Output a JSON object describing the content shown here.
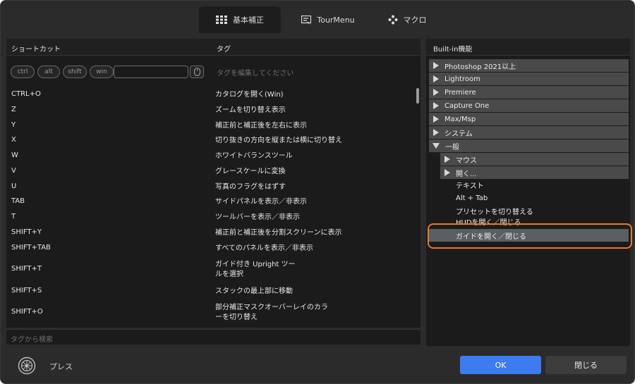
{
  "tabs": [
    {
      "label": "基本補正",
      "icon": "grid-icon",
      "active": true
    },
    {
      "label": "TourMenu",
      "icon": "menu-card-icon",
      "active": false
    },
    {
      "label": "マクロ",
      "icon": "macro-dots-icon",
      "active": false
    }
  ],
  "left": {
    "col_shortcut": "ショートカット",
    "col_tag": "タグ",
    "modifiers": [
      "ctrl",
      "alt",
      "shift",
      "win"
    ],
    "tag_edit_placeholder": "タグを編集してください",
    "rows": [
      {
        "key": "CTRL+O",
        "tag": "カタログを開く(Win)"
      },
      {
        "key": "Z",
        "tag": "ズームを切り替え表示"
      },
      {
        "key": "Y",
        "tag": "補正前と補正後を左右に表示"
      },
      {
        "key": "X",
        "tag": "切り抜きの方向を縦または横に切り替え"
      },
      {
        "key": "W",
        "tag": "ホワイトバランスツール"
      },
      {
        "key": "V",
        "tag": "グレースケールに変換"
      },
      {
        "key": "U",
        "tag": "写真のフラグをはずす"
      },
      {
        "key": "TAB",
        "tag": "サイドパネルを表示／非表示"
      },
      {
        "key": "T",
        "tag": "ツールバーを表示／非表示"
      },
      {
        "key": "SHIFT+Y",
        "tag": "補正前と補正後を分割スクリーンに表示"
      },
      {
        "key": "SHIFT+TAB",
        "tag": "すべてのパネルを表示／非表示"
      },
      {
        "key": "SHIFT+T",
        "tag": "ガイド付き Upright ツールを選択"
      },
      {
        "key": "SHIFT+S",
        "tag": "スタックの最上部に移動"
      },
      {
        "key": "SHIFT+O",
        "tag": "部分補正マスクオーバーレイのカラーを切り替え"
      }
    ],
    "search_placeholder": "タグから検索"
  },
  "right": {
    "header": "Built-in機能",
    "categories": [
      "Photoshop 2021以上",
      "Lightroom",
      "Premiere",
      "Capture One",
      "Max/Msp",
      "システム"
    ],
    "open_category": "一般",
    "subcategories": [
      "マウス",
      "開く..."
    ],
    "leaves": [
      "テキスト",
      "Alt + Tab",
      "プリセットを切り替える",
      "HUDを開く／閉じる"
    ],
    "selected": "ガイドを開く／閉じる"
  },
  "footer": {
    "label": "プレス",
    "ok": "OK",
    "close": "閉じる"
  },
  "colors": {
    "accent": "#3c7bf0",
    "highlight": "#e8782a"
  }
}
